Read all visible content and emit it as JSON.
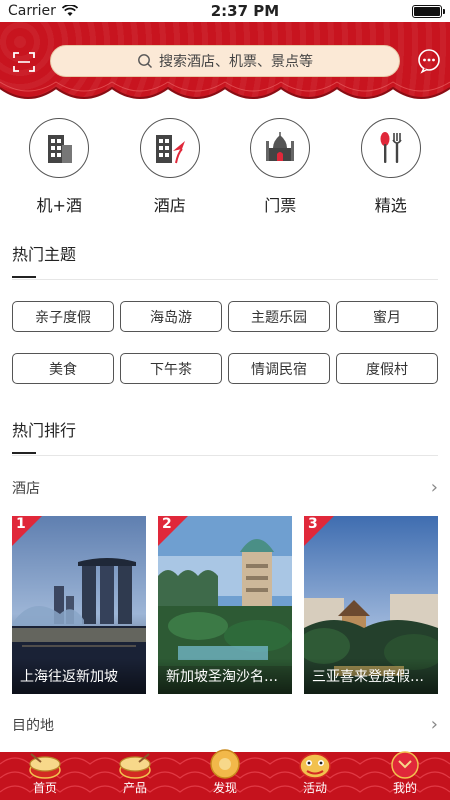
{
  "status_bar": {
    "carrier": "Carrier",
    "time": "2:37 PM"
  },
  "header": {
    "search_placeholder": "搜索酒店、机票、景点等"
  },
  "categories": [
    {
      "label": "机+酒",
      "icon": "flight-hotel-icon"
    },
    {
      "label": "酒店",
      "icon": "hotel-icon"
    },
    {
      "label": "门票",
      "icon": "ticket-landmark-icon"
    },
    {
      "label": "精选",
      "icon": "dining-icon"
    }
  ],
  "hot_topics": {
    "title": "热门主题",
    "tags": [
      "亲子度假",
      "海岛游",
      "主题乐园",
      "蜜月",
      "美食",
      "下午茶",
      "情调民宿",
      "度假村"
    ]
  },
  "hot_ranking": {
    "title": "热门排行",
    "hotel_label": "酒店",
    "destination_label": "目的地",
    "cards": [
      {
        "rank": "1",
        "caption": "上海往返新加坡"
      },
      {
        "rank": "2",
        "caption": "新加坡圣淘沙名胜世界"
      },
      {
        "rank": "3",
        "caption": "三亚喜来登度假酒店"
      }
    ]
  },
  "tab_bar": {
    "tabs": [
      {
        "label": "首页",
        "icon": "drum-icon"
      },
      {
        "label": "产品",
        "icon": "drum-icon"
      },
      {
        "label": "发现",
        "icon": "gong-icon"
      },
      {
        "label": "活动",
        "icon": "lion-dance-icon"
      },
      {
        "label": "我的",
        "icon": "red-envelope-icon"
      }
    ]
  },
  "colors": {
    "brand_red": "#c8141f",
    "search_bg": "#fbe9d6",
    "rank_red": "#e0283a"
  }
}
